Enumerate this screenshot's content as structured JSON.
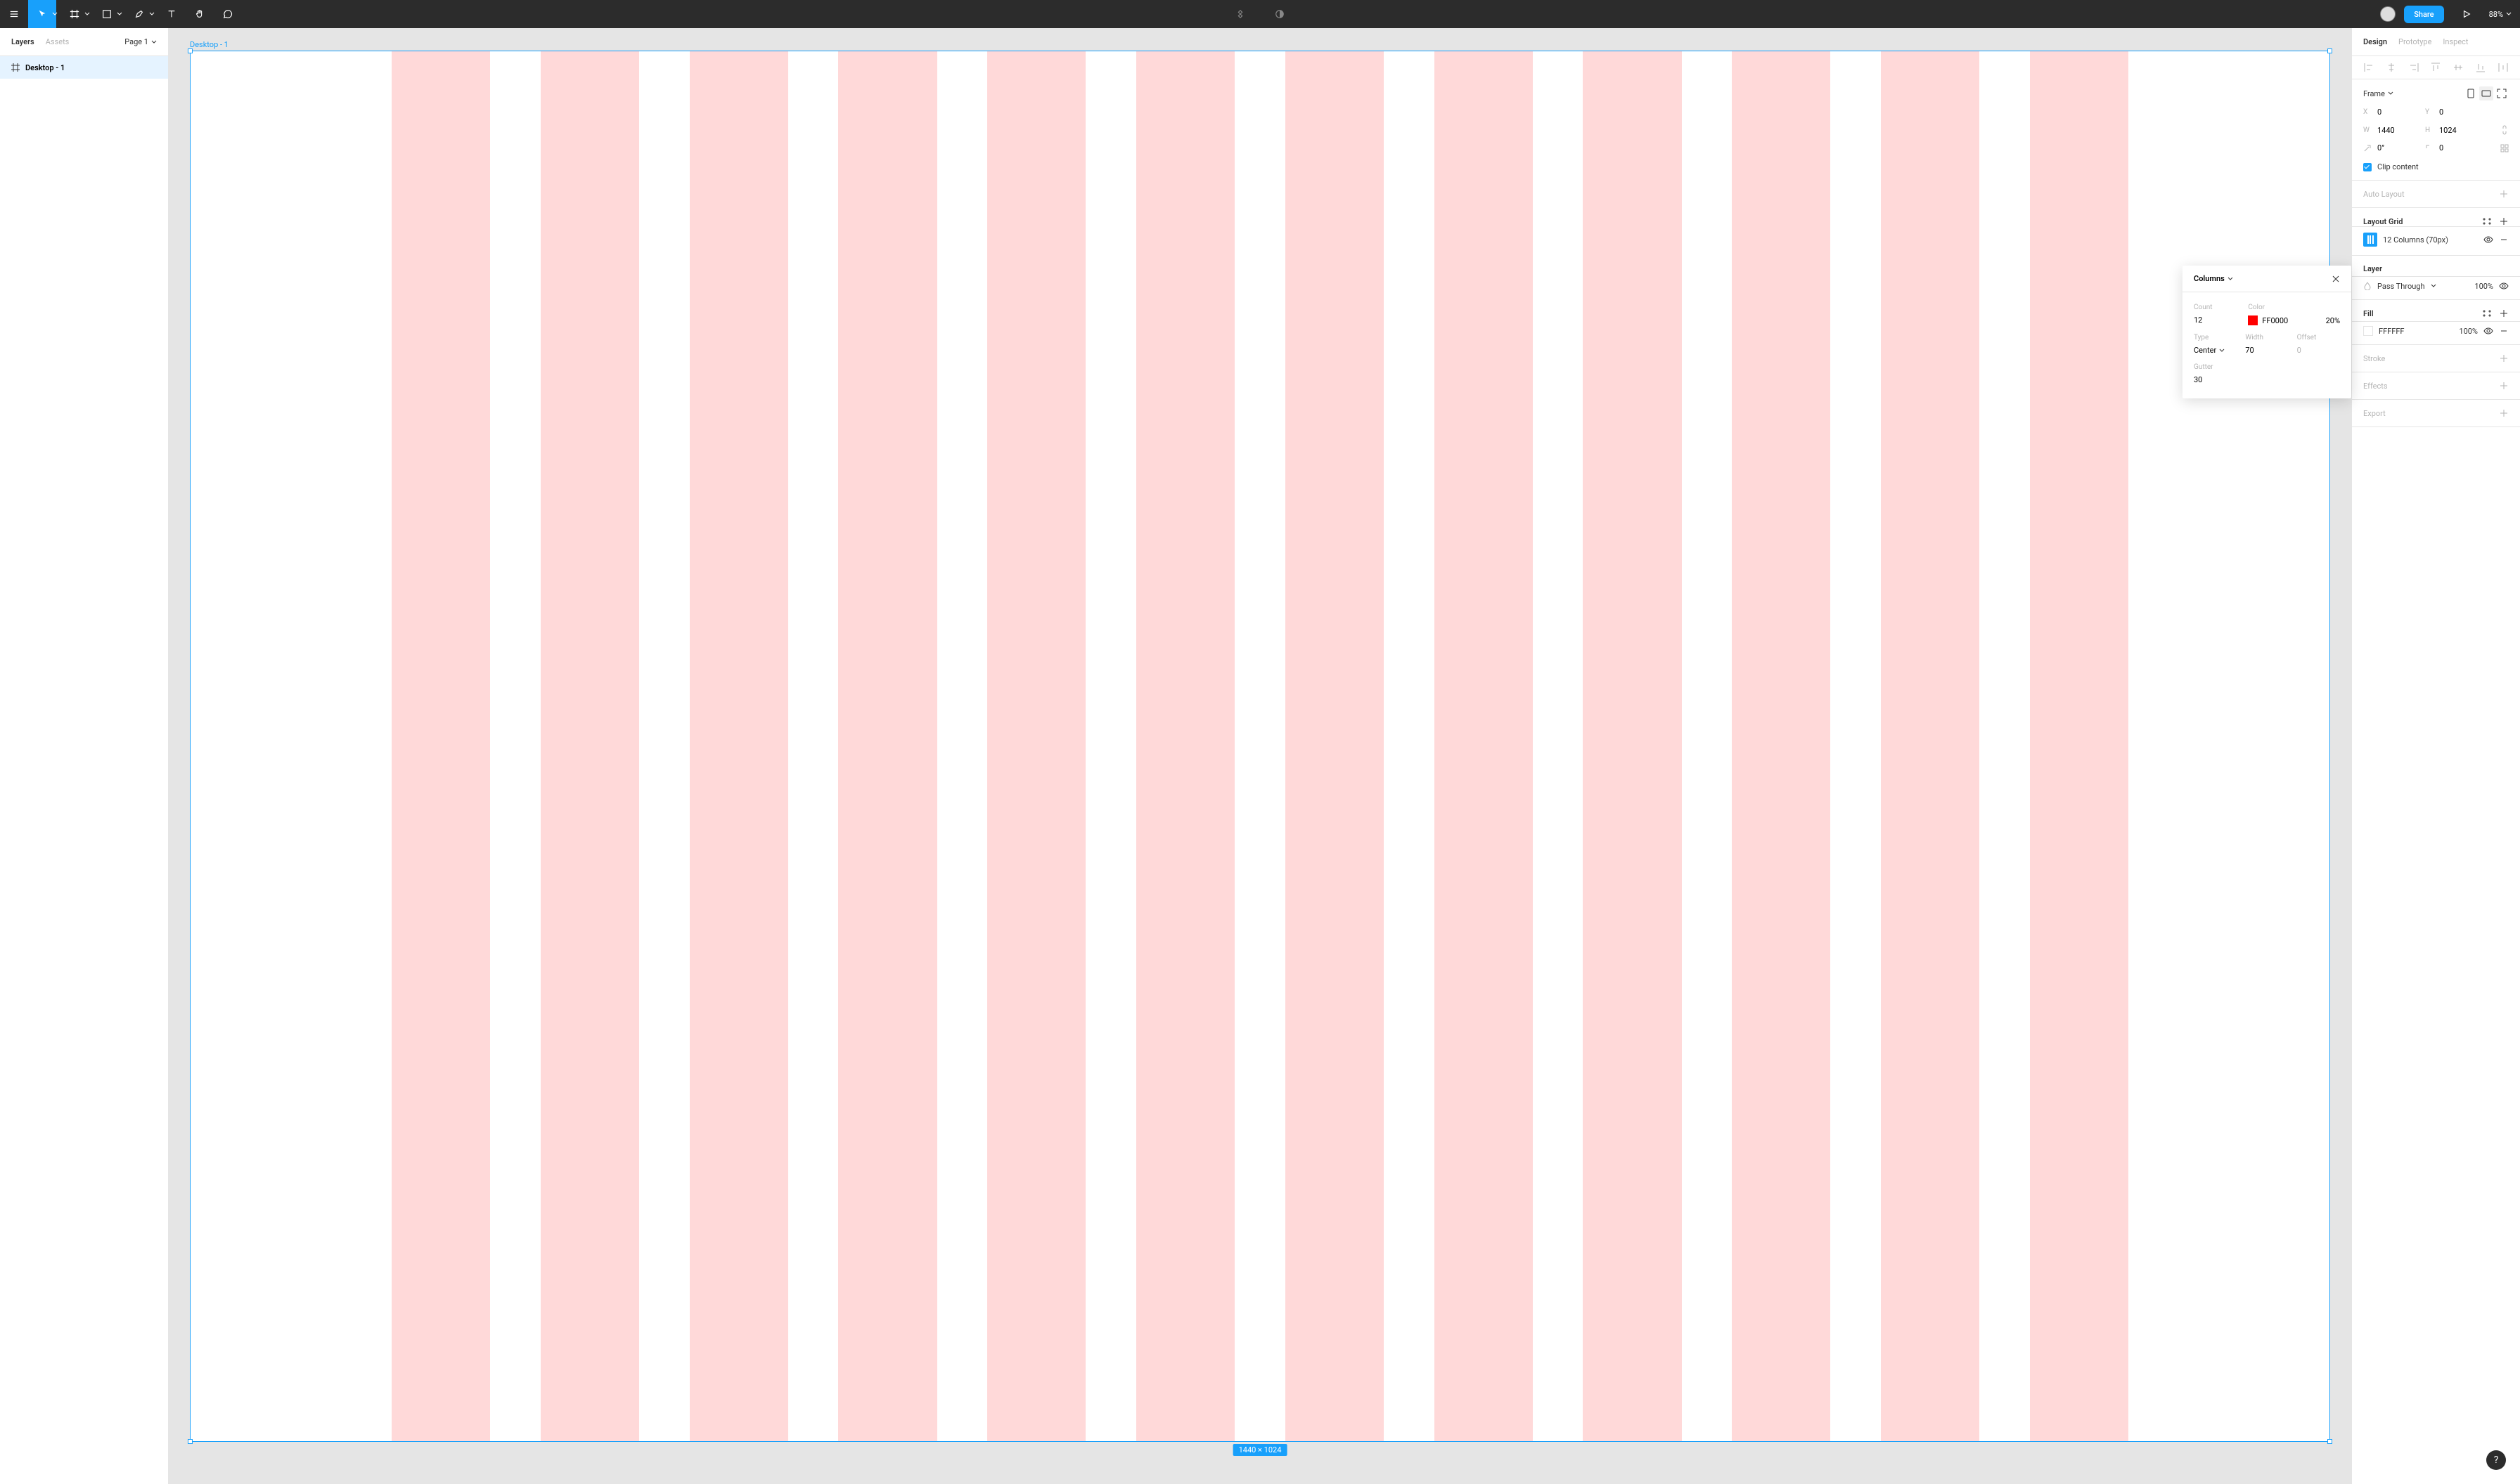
{
  "toolbar": {
    "share_label": "Share",
    "zoom": "88%"
  },
  "left_panel": {
    "tabs": {
      "layers": "Layers",
      "assets": "Assets"
    },
    "page": "Page 1",
    "layer_name": "Desktop - 1"
  },
  "canvas": {
    "frame_label": "Desktop - 1",
    "dimensions": "1440 × 1024"
  },
  "popup": {
    "title": "Columns",
    "count_label": "Count",
    "count": "12",
    "color_label": "Color",
    "color_hex": "FF0000",
    "color_opacity": "20%",
    "type_label": "Type",
    "type": "Center",
    "width_label": "Width",
    "width": "70",
    "offset_label": "Offset",
    "offset": "0",
    "gutter_label": "Gutter",
    "gutter": "30"
  },
  "right_panel": {
    "tabs": {
      "design": "Design",
      "prototype": "Prototype",
      "inspect": "Inspect"
    },
    "frame_label": "Frame",
    "x": "0",
    "y": "0",
    "w": "1440",
    "h": "1024",
    "rotation": "0°",
    "radius": "0",
    "clip_content": "Clip content",
    "auto_layout": "Auto Layout",
    "layout_grid": "Layout Grid",
    "grid_item": "12 Columns (70px)",
    "layer_section": "Layer",
    "blend_mode": "Pass Through",
    "layer_opacity": "100%",
    "fill_section": "Fill",
    "fill_hex": "FFFFFF",
    "fill_opacity": "100%",
    "stroke_section": "Stroke",
    "effects_section": "Effects",
    "export_section": "Export"
  },
  "help": "?"
}
